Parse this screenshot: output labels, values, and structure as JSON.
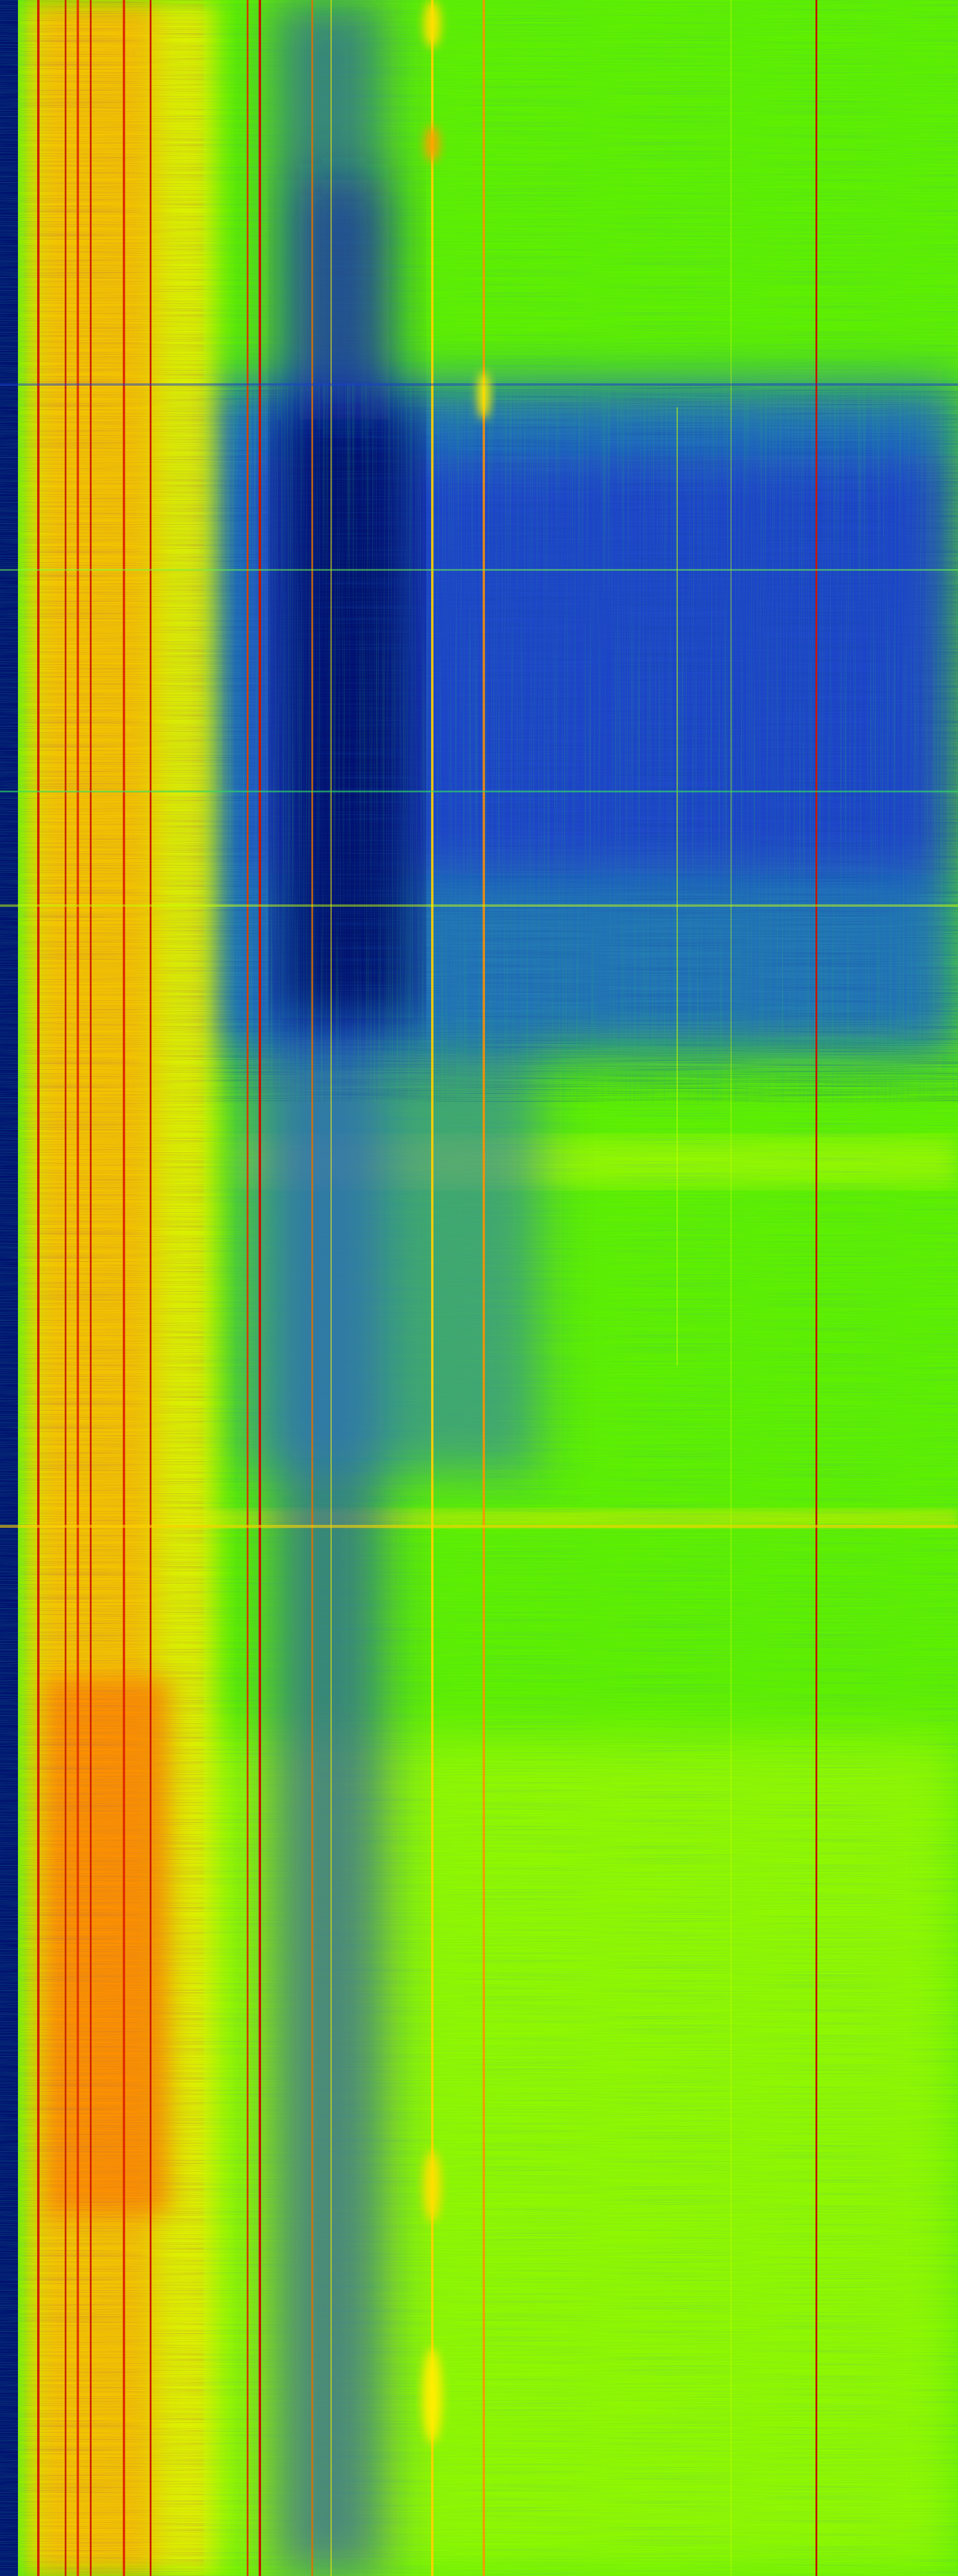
{
  "image": {
    "kind": "spectrogram-waterfall",
    "colormap": [
      "#000000",
      "#000a8c",
      "#1a40d8",
      "#2a8ad0",
      "#22c070",
      "#66ff00",
      "#c8ff00",
      "#ffee00",
      "#ffa000",
      "#e84000",
      "#b00000"
    ],
    "text_labels": []
  }
}
